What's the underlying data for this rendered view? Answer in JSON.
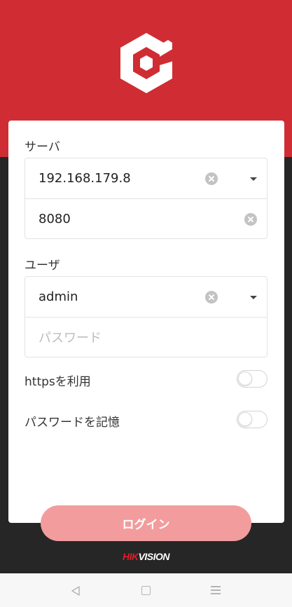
{
  "server": {
    "section_label": "サーバ",
    "address_value": "192.168.179.8",
    "port_value": "8080"
  },
  "user": {
    "section_label": "ユーザ",
    "username_value": "admin",
    "password_placeholder": "パスワード"
  },
  "options": {
    "https_label": "httpsを利用",
    "https_enabled": false,
    "remember_label": "パスワードを記憶",
    "remember_enabled": false
  },
  "login_button_label": "ログイン",
  "brand": {
    "part1": "HIK",
    "part2": "VISION"
  },
  "colors": {
    "header_red": "#cf2d33",
    "button_pink": "#f39c9d",
    "background_dark": "#262626"
  },
  "icons": [
    "app-logo-icon",
    "clear-icon",
    "dropdown-icon",
    "nav-back-icon",
    "nav-home-icon",
    "nav-menu-icon"
  ]
}
